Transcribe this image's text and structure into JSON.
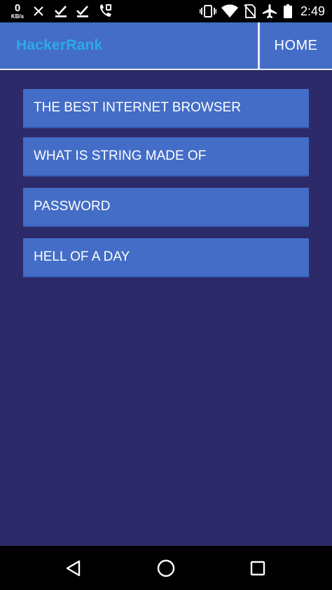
{
  "status_bar": {
    "net_speed_value": "0",
    "net_speed_unit": "KB/s",
    "time": "2:49",
    "icons": [
      "close-icon",
      "check-download-icon",
      "check-download-icon",
      "phone-wifi-icon",
      "vibrate-icon",
      "wifi-icon",
      "no-sim-icon",
      "airplane-icon",
      "battery-icon"
    ]
  },
  "app_bar": {
    "brand": "HackerRank",
    "home_label": "HOME",
    "colors": {
      "bar": "#436dc6",
      "brand": "#2ea8e8",
      "divider": "#e9ecf5"
    }
  },
  "menu": {
    "items": [
      {
        "label": "THE BEST INTERNET BROWSER"
      },
      {
        "label": "WHAT IS STRING MADE OF"
      },
      {
        "label": "PASSWORD"
      },
      {
        "label": "HELL OF A DAY"
      }
    ]
  },
  "theme": {
    "background": "#2d2a69",
    "item": "#436dc6"
  },
  "nav_bar": {
    "icons": [
      "back-icon",
      "home-circle-icon",
      "recents-icon"
    ]
  }
}
